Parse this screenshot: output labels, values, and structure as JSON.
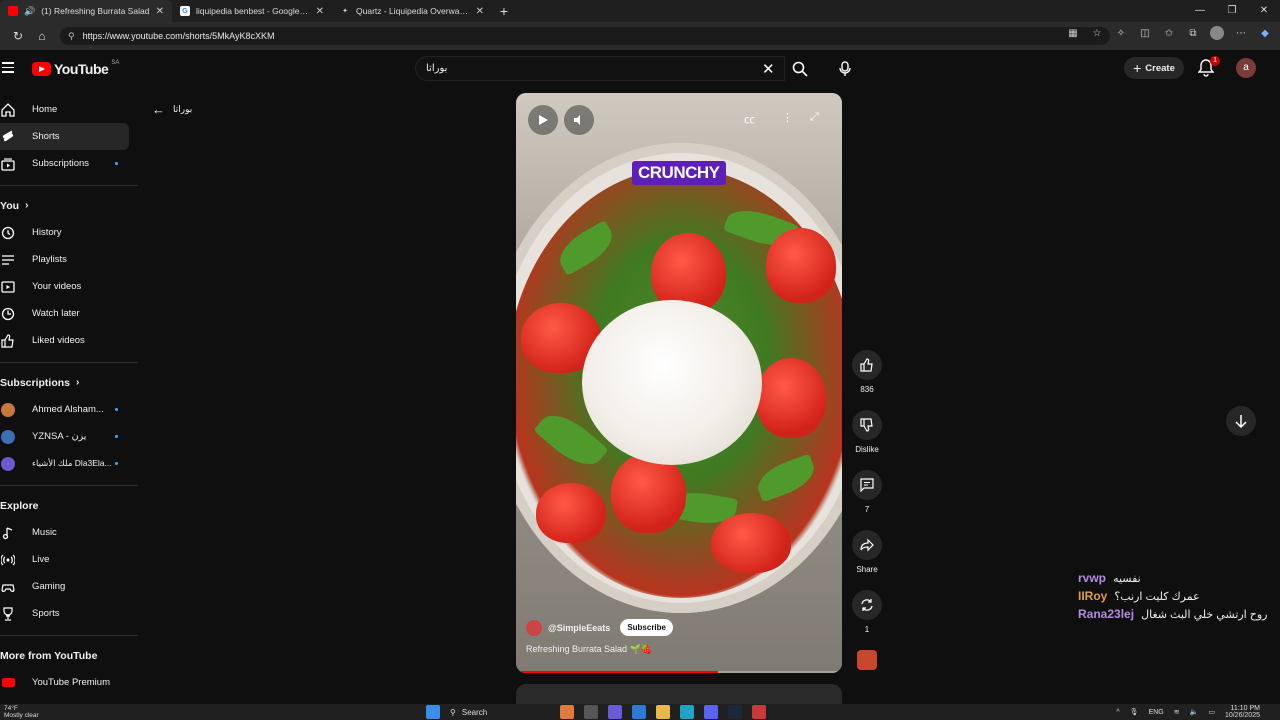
{
  "browser": {
    "tabs": [
      {
        "title": "(1) Refreshing Burrata Salad",
        "favicon_color": "#ff0000",
        "active": true
      },
      {
        "title": "liquipedia benbest - Google Sear",
        "favicon_color": "#4285f4",
        "active": false
      },
      {
        "title": "Quartz - Liquipedia Overwatch W",
        "favicon_color": "#bbbbbb",
        "active": false
      }
    ],
    "url": "https://www.youtube.com/shorts/5MkAyK8cXKM"
  },
  "header": {
    "logo_text": "YouTube",
    "logo_region": "SA",
    "search_query": "بوراتا",
    "create_label": "Create",
    "notification_count": "1",
    "avatar_letter": "a"
  },
  "sidebar": {
    "main": [
      {
        "label": "Home",
        "icon": "home-icon"
      },
      {
        "label": "Shorts",
        "icon": "shorts-icon",
        "active": true
      },
      {
        "label": "Subscriptions",
        "icon": "subscriptions-icon",
        "dot": true
      }
    ],
    "you_title": "You",
    "you": [
      {
        "label": "History",
        "icon": "history-icon"
      },
      {
        "label": "Playlists",
        "icon": "playlists-icon"
      },
      {
        "label": "Your videos",
        "icon": "your-videos-icon"
      },
      {
        "label": "Watch later",
        "icon": "watch-later-icon"
      },
      {
        "label": "Liked videos",
        "icon": "liked-videos-icon"
      }
    ],
    "subscriptions_title": "Subscriptions",
    "subscriptions": [
      {
        "label": "Ahmed Alsham...",
        "color": "#c9783c"
      },
      {
        "label": "YZNSA - يزن",
        "color": "#3b6fb6"
      },
      {
        "label": "ملك الأشياء Dla3Ela...",
        "color": "#6a5acd"
      }
    ],
    "explore_title": "Explore",
    "explore": [
      {
        "label": "Music",
        "icon": "music-icon"
      },
      {
        "label": "Live",
        "icon": "live-icon"
      },
      {
        "label": "Gaming",
        "icon": "gaming-icon"
      },
      {
        "label": "Sports",
        "icon": "sports-icon"
      }
    ],
    "more_title": "More from YouTube",
    "more": [
      {
        "label": "YouTube Premium",
        "icon": "youtube-premium-icon"
      }
    ]
  },
  "back_label": "بوراتا",
  "video": {
    "overlay_text": "CRUNCHY",
    "channel": "@SimpleEeats",
    "subscribe_label": "Subscribe",
    "title": "Refreshing Burrata Salad 🌱🍓",
    "progress": 0.62
  },
  "actions": {
    "likes": "836",
    "dislike_label": "Dislike",
    "comments": "7",
    "share_label": "Share",
    "remix": "1"
  },
  "chat": [
    {
      "user": "rvwp",
      "message": "نفسيه",
      "color": "#b48ce0"
    },
    {
      "user": "IIRoy",
      "message": "عمرك كليت ارنب؟",
      "color": "#e0a040"
    },
    {
      "user": "Rana23lej",
      "message": "روح ارتشي خلي البث شغال",
      "color": "#b48ce0"
    }
  ],
  "taskbar": {
    "temperature": "74°F",
    "weather": "Mostly clear",
    "search_label": "Search",
    "language": "ENG",
    "time": "11:10 PM",
    "date": "10/26/2025"
  },
  "colors": {
    "accent": "#ff0000",
    "background": "#0f0f0f",
    "link": "#3ea6ff"
  }
}
